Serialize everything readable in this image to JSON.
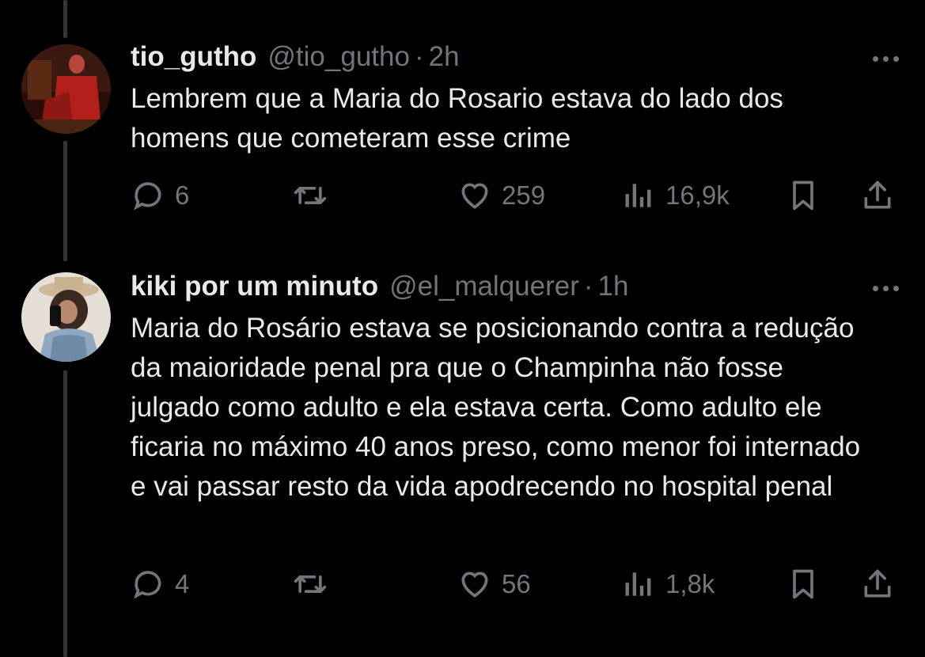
{
  "tweets": [
    {
      "name": "tio_gutho",
      "handle": "@tio_gutho",
      "separator": "·",
      "time": "2h",
      "text": "Lembrem que a Maria do Rosario estava do lado dos homens que cometeram esse crime",
      "replies": "6",
      "reposts": "",
      "likes": "259",
      "views": "16,9k"
    },
    {
      "name": "kiki por um minuto",
      "handle": "@el_malquerer",
      "separator": "·",
      "time": "1h",
      "text": "Maria do Rosário estava se posicionando contra a redução da maioridade penal pra que o Champinha não fosse julgado como adulto e ela estava certa. Como adulto ele ficaria no máximo 40 anos preso, como menor foi internado e vai passar resto da vida apodrecendo no hospital penal",
      "replies": "4",
      "reposts": "",
      "likes": "56",
      "views": "1,8k"
    }
  ],
  "icons": [
    "reply-icon",
    "repost-icon",
    "like-icon",
    "views-icon",
    "bookmark-icon",
    "share-icon",
    "more-icon"
  ],
  "colors": {
    "background": "#000000",
    "text": "#e7e9ea",
    "muted": "#71767b",
    "thread_line": "#333639"
  }
}
